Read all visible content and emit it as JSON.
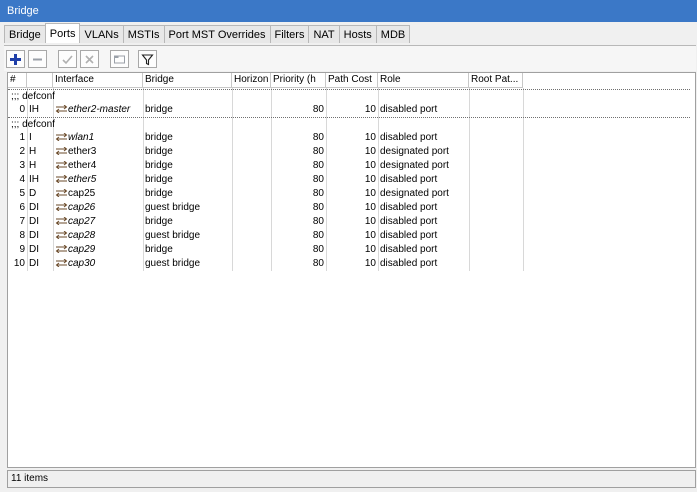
{
  "window": {
    "title": "Bridge"
  },
  "tabs": [
    {
      "label": "Bridge",
      "active": false
    },
    {
      "label": "Ports",
      "active": true
    },
    {
      "label": "VLANs",
      "active": false
    },
    {
      "label": "MSTIs",
      "active": false
    },
    {
      "label": "Port MST Overrides",
      "active": false
    },
    {
      "label": "Filters",
      "active": false
    },
    {
      "label": "NAT",
      "active": false
    },
    {
      "label": "Hosts",
      "active": false
    },
    {
      "label": "MDB",
      "active": false
    }
  ],
  "toolbar": {
    "icons": [
      "add-icon",
      "remove-icon",
      "enable-icon",
      "disable-icon",
      "comment-icon",
      "filter-icon"
    ],
    "accent": "#1f3fa8"
  },
  "columns": [
    "#",
    "",
    "Interface",
    "Bridge",
    "Horizon",
    "Priority (h",
    "Path Cost",
    "Role",
    "Root Pat..."
  ],
  "groups": [
    {
      "comment": ";;; defconf",
      "rows": [
        {
          "num": "0",
          "flags": "IH",
          "iface": "ether2-master",
          "italic": true,
          "bridge": "bridge",
          "horizon": "",
          "priority": "80",
          "path_cost": "10",
          "role": "disabled port",
          "root_path": ""
        }
      ]
    },
    {
      "comment": ";;; defconf",
      "rows": [
        {
          "num": "1",
          "flags": "I",
          "iface": "wlan1",
          "italic": true,
          "bridge": "bridge",
          "horizon": "",
          "priority": "80",
          "path_cost": "10",
          "role": "disabled port",
          "root_path": ""
        },
        {
          "num": "2",
          "flags": "H",
          "iface": "ether3",
          "italic": false,
          "bridge": "bridge",
          "horizon": "",
          "priority": "80",
          "path_cost": "10",
          "role": "designated port",
          "root_path": ""
        },
        {
          "num": "3",
          "flags": "H",
          "iface": "ether4",
          "italic": false,
          "bridge": "bridge",
          "horizon": "",
          "priority": "80",
          "path_cost": "10",
          "role": "designated port",
          "root_path": ""
        },
        {
          "num": "4",
          "flags": "IH",
          "iface": "ether5",
          "italic": true,
          "bridge": "bridge",
          "horizon": "",
          "priority": "80",
          "path_cost": "10",
          "role": "disabled port",
          "root_path": ""
        },
        {
          "num": "5",
          "flags": "D",
          "iface": "cap25",
          "italic": false,
          "bridge": "bridge",
          "horizon": "",
          "priority": "80",
          "path_cost": "10",
          "role": "designated port",
          "root_path": ""
        },
        {
          "num": "6",
          "flags": "DI",
          "iface": "cap26",
          "italic": true,
          "bridge": "guest bridge",
          "horizon": "",
          "priority": "80",
          "path_cost": "10",
          "role": "disabled port",
          "root_path": ""
        },
        {
          "num": "7",
          "flags": "DI",
          "iface": "cap27",
          "italic": true,
          "bridge": "bridge",
          "horizon": "",
          "priority": "80",
          "path_cost": "10",
          "role": "disabled port",
          "root_path": ""
        },
        {
          "num": "8",
          "flags": "DI",
          "iface": "cap28",
          "italic": true,
          "bridge": "guest bridge",
          "horizon": "",
          "priority": "80",
          "path_cost": "10",
          "role": "disabled port",
          "root_path": ""
        },
        {
          "num": "9",
          "flags": "DI",
          "iface": "cap29",
          "italic": true,
          "bridge": "bridge",
          "horizon": "",
          "priority": "80",
          "path_cost": "10",
          "role": "disabled port",
          "root_path": ""
        },
        {
          "num": "10",
          "flags": "DI",
          "iface": "cap30",
          "italic": true,
          "bridge": "guest bridge",
          "horizon": "",
          "priority": "80",
          "path_cost": "10",
          "role": "disabled port",
          "root_path": ""
        }
      ]
    }
  ],
  "status": {
    "text": "11 items"
  }
}
